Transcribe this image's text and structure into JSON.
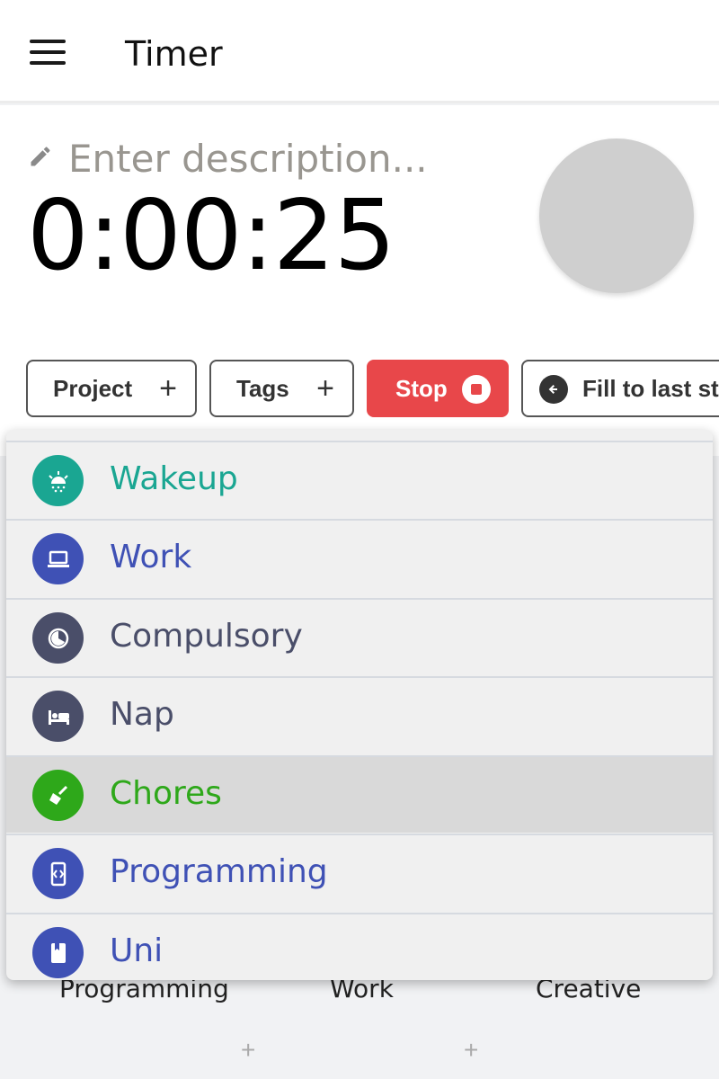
{
  "header": {
    "title": "Timer"
  },
  "timer": {
    "description_placeholder": "Enter description...",
    "elapsed": "0:00:25"
  },
  "chips": {
    "project": "Project",
    "tags": "Tags",
    "stop": "Stop",
    "fill": "Fill to last stop"
  },
  "dropdown": {
    "items": [
      {
        "label": "Wakeup",
        "icon": "sunrise-icon",
        "color": "#1aa692"
      },
      {
        "label": "Work",
        "icon": "laptop-icon",
        "color": "#3f51b5"
      },
      {
        "label": "Compulsory",
        "icon": "clock-icon",
        "color": "#4a4e69"
      },
      {
        "label": "Nap",
        "icon": "bed-icon",
        "color": "#4a4e69"
      },
      {
        "label": "Chores",
        "icon": "broom-icon",
        "color": "#2ea81a",
        "highlighted": true
      },
      {
        "label": "Programming",
        "icon": "code-icon",
        "color": "#3f51b5"
      },
      {
        "label": "Uni",
        "icon": "book-icon",
        "color": "#3f51b5"
      }
    ]
  },
  "background_tiles": [
    "Programming",
    "Work",
    "Creative"
  ],
  "colors": {
    "stop": "#e8474a",
    "avatar": "#cfcfcf"
  }
}
